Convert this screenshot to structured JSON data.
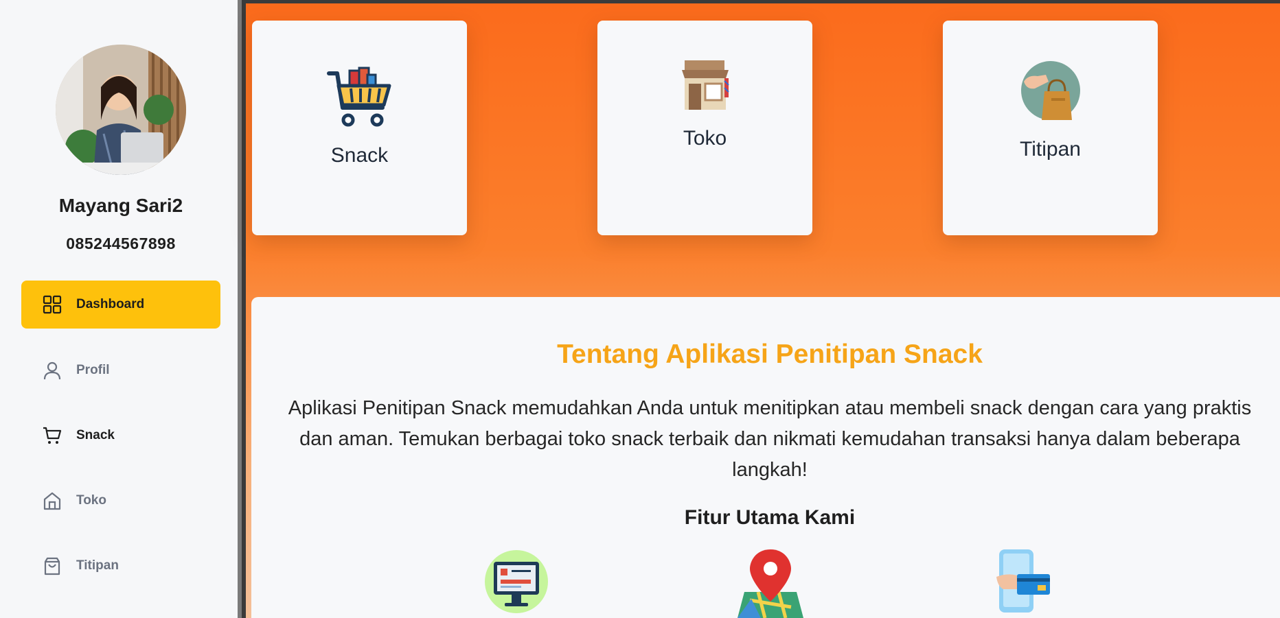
{
  "user": {
    "name": "Mayang Sari2",
    "phone": "085244567898"
  },
  "sidebar": {
    "items": [
      {
        "label": "Dashboard",
        "icon": "grid-icon",
        "active": true
      },
      {
        "label": "Profil",
        "icon": "user-icon",
        "active": false
      },
      {
        "label": "Snack",
        "icon": "cart-icon",
        "active": false
      },
      {
        "label": "Toko",
        "icon": "home-icon",
        "active": false
      },
      {
        "label": "Titipan",
        "icon": "bag-icon",
        "active": false
      }
    ]
  },
  "cards": [
    {
      "label": "Snack",
      "icon": "shopping-cart-icon"
    },
    {
      "label": "Toko",
      "icon": "store-icon"
    },
    {
      "label": "Titipan",
      "icon": "shopping-bag-hand-icon"
    }
  ],
  "about": {
    "title": "Tentang Aplikasi Penitipan Snack",
    "text": "Aplikasi Penitipan Snack memudahkan Anda untuk menitipkan atau membeli snack dengan cara yang praktis dan aman. Temukan berbagai toko snack terbaik dan nikmati kemudahan transaksi hanya dalam beberapa langkah!",
    "features_title": "Fitur Utama Kami",
    "features": [
      {
        "icon": "online-store-monitor-icon"
      },
      {
        "icon": "location-map-pin-icon"
      },
      {
        "icon": "mobile-payment-icon"
      }
    ]
  },
  "colors": {
    "accent": "#fec10c",
    "title_orange": "#f6a418",
    "gradient_top": "#fb6b1c",
    "gradient_bottom": "#f4c099"
  }
}
